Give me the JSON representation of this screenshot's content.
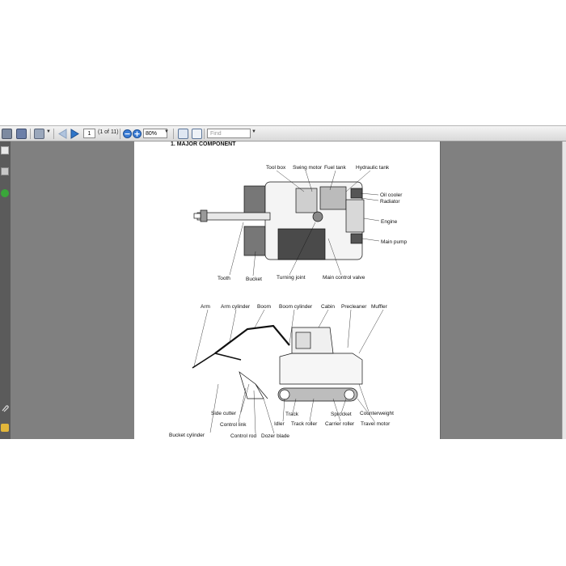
{
  "toolbar": {
    "page_value": "1",
    "page_count": "(1 of 11)",
    "zoom_value": "80%",
    "find_placeholder": "Find"
  },
  "document": {
    "heading": "1.  MAJOR COMPONENT",
    "top_view_labels": {
      "tool_box": "Tool box",
      "swing_motor": "Swing motor",
      "fuel_tank": "Fuel tank",
      "hydraulic_tank": "Hydraulic tank",
      "oil_cooler": "Oil cooler",
      "radiator": "Radiator",
      "engine": "Engine",
      "main_pump": "Main pump",
      "tooth": "Tooth",
      "bucket": "Bucket",
      "turning_joint": "Turning joint",
      "main_control_valve": "Main control valve"
    },
    "side_view_labels": {
      "arm": "Arm",
      "arm_cylinder": "Arm cylinder",
      "boom": "Boom",
      "boom_cylinder": "Boom cylinder",
      "cabin": "Cabin",
      "precleaner": "Precleaner",
      "muffler": "Muffler",
      "side_cutter": "Side cutter",
      "control_link": "Control link",
      "bucket_cylinder": "Bucket cylinder",
      "control_rod": "Control rod",
      "dozer_blade": "Dozer blade",
      "idler": "Idler",
      "track": "Track",
      "track_roller": "Track roller",
      "sprocket": "Sprocket",
      "carrier_roller": "Carrier roller",
      "counterweight": "Counterweight",
      "travel_motor": "Travel motor"
    }
  }
}
